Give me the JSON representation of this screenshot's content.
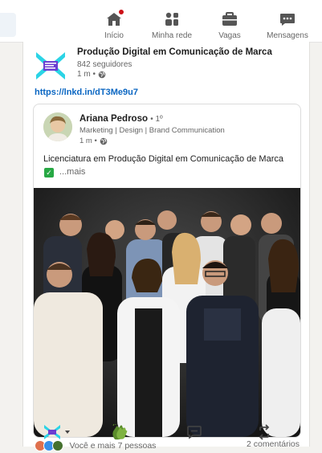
{
  "nav": {
    "items": [
      {
        "label": "Início",
        "icon": "home-icon",
        "has_badge": true
      },
      {
        "label": "Minha rede",
        "icon": "network-icon"
      },
      {
        "label": "Vagas",
        "icon": "briefcase-icon"
      },
      {
        "label": "Mensagens",
        "icon": "messaging-icon"
      }
    ]
  },
  "post": {
    "author_name": "Produção Digital em Comunicação de Marca",
    "followers": "842 seguidores",
    "time": "1 m •",
    "link": "https://lnkd.in/dT3Me9u7",
    "shared": {
      "author_name": "Ariana Pedroso",
      "degree": "• 1º",
      "headline": "Marketing | Design | Brand Communication",
      "time": "1 m •",
      "text": "Licenciatura em Produção Digital em Comunicação de Marca",
      "more": "...mais"
    },
    "reactions_text": "Você e mais 7 pessoas",
    "comments_text": "2 comentários"
  },
  "colors": {
    "brand_blue": "#0a66c2",
    "logo_cyan": "#2bd4e6",
    "logo_purple": "#6b3fd1"
  }
}
